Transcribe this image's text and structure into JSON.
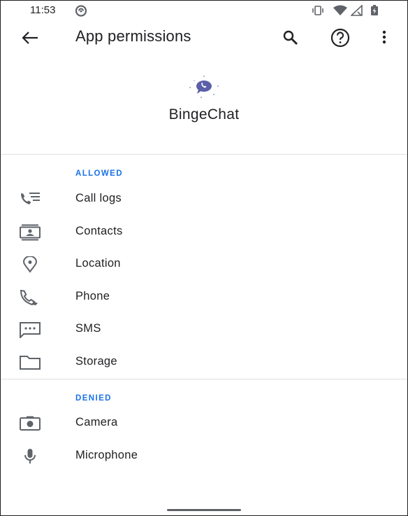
{
  "status_bar": {
    "time": "11:53",
    "left_icons": [
      "no-disturb-icon"
    ],
    "right_icons": [
      "vibrate-icon",
      "wifi-icon",
      "signal-icon",
      "battery-icon"
    ]
  },
  "toolbar": {
    "title": "App permissions",
    "icons": [
      "back-arrow-icon",
      "search-icon",
      "help-icon",
      "more-vert-icon"
    ]
  },
  "app": {
    "name": "BingeChat",
    "icon": "chat-bubble-phone-icon",
    "accent_color": "#5c5fa8"
  },
  "allowed": {
    "label": "ALLOWED",
    "items": [
      {
        "label": "Call logs",
        "icon": "call-log-icon"
      },
      {
        "label": "Contacts",
        "icon": "contacts-icon"
      },
      {
        "label": "Location",
        "icon": "location-icon"
      },
      {
        "label": "Phone",
        "icon": "phone-icon"
      },
      {
        "label": "SMS",
        "icon": "sms-icon"
      },
      {
        "label": "Storage",
        "icon": "folder-icon"
      }
    ]
  },
  "denied": {
    "label": "DENIED",
    "items": [
      {
        "label": "Camera",
        "icon": "camera-icon"
      },
      {
        "label": "Microphone",
        "icon": "microphone-icon"
      }
    ]
  },
  "colors": {
    "section_label": "#1a73e8",
    "icon_gray": "#5f6368",
    "text": "#202124"
  }
}
